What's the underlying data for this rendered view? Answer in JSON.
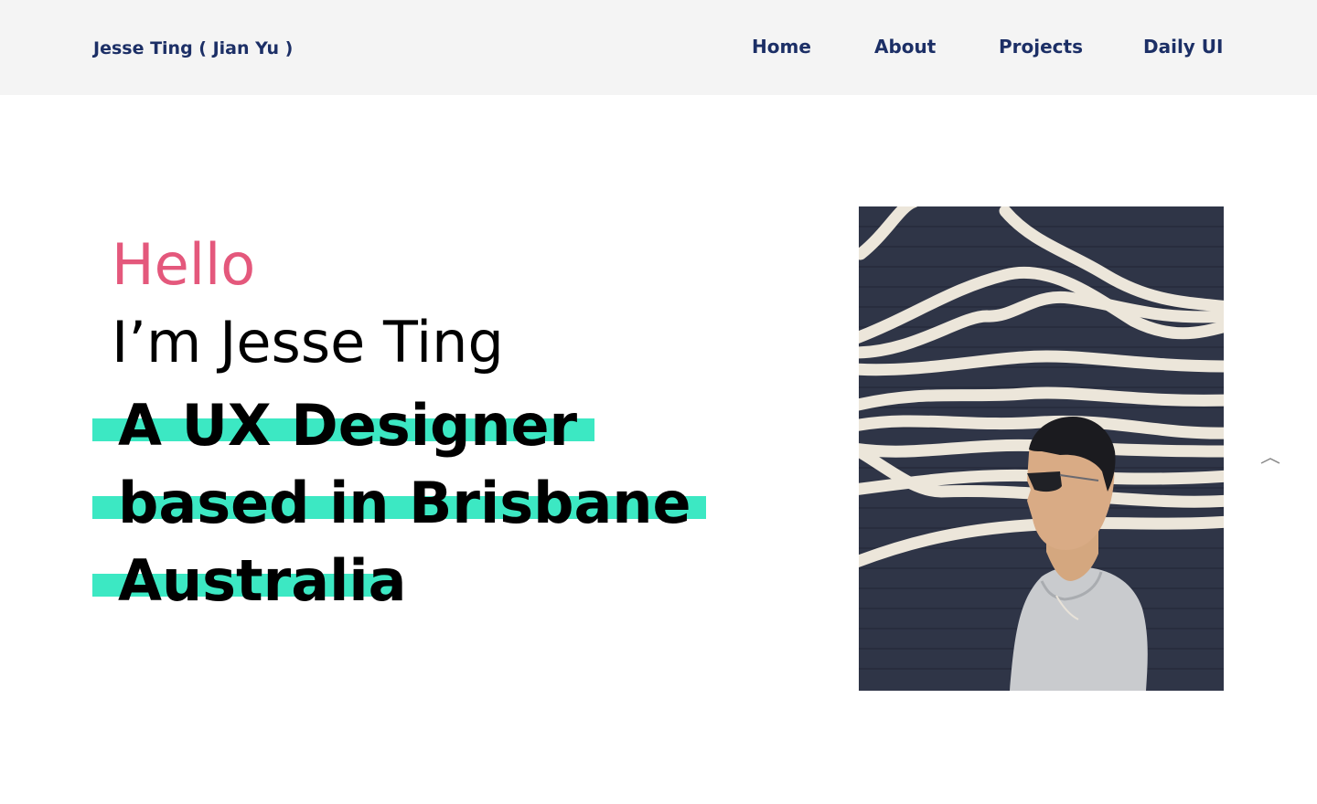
{
  "header": {
    "brand": "Jesse Ting ( Jian Yu )",
    "nav": [
      "Home",
      "About",
      "Projects",
      "Daily UI"
    ]
  },
  "hero": {
    "greeting": "Hello",
    "intro": "I’m Jesse Ting",
    "tagline_lines": [
      "A UX Designer",
      "based in Brisbane",
      "Australia"
    ]
  },
  "colors": {
    "nav_text": "#1c2f66",
    "greeting": "#e4587c",
    "highlight": "#3ce8c3",
    "header_bg": "#f4f4f4",
    "wall": "#2e3446"
  },
  "icons": {
    "scroll_top": "chevron-up-icon"
  }
}
